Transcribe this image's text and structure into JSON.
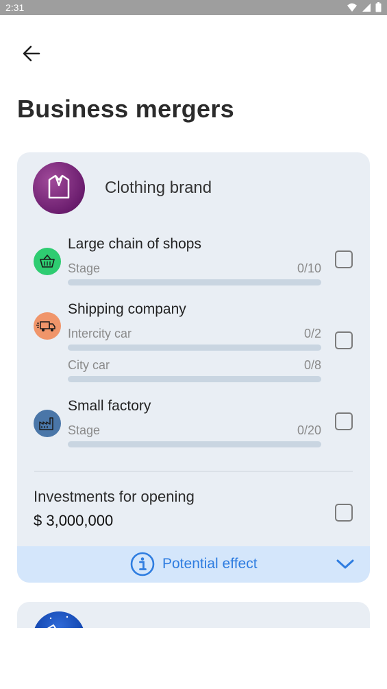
{
  "status_bar": {
    "time": "2:31"
  },
  "page": {
    "title": "Business mergers"
  },
  "card": {
    "name": "Clothing brand",
    "rows": [
      {
        "title": "Large chain of shops",
        "stages": [
          {
            "label": "Stage",
            "value": "0/10"
          }
        ],
        "icon": "basket-icon",
        "icon_color": "#2ecc71"
      },
      {
        "title": "Shipping company",
        "stages": [
          {
            "label": "Intercity car",
            "value": "0/2"
          },
          {
            "label": "City car",
            "value": "0/8"
          }
        ],
        "icon": "truck-icon",
        "icon_color": "#f0956a"
      },
      {
        "title": "Small factory",
        "stages": [
          {
            "label": "Stage",
            "value": "0/20"
          }
        ],
        "icon": "factory-icon",
        "icon_color": "#4a76a8"
      }
    ],
    "investments": {
      "label": "Investments for opening",
      "value": "$ 3,000,000"
    },
    "effect": {
      "label": "Potential effect"
    }
  },
  "colors": {
    "accent": "#2f7de0",
    "card_bg": "#e9eef4",
    "effect_bg": "#d4e6fb"
  }
}
